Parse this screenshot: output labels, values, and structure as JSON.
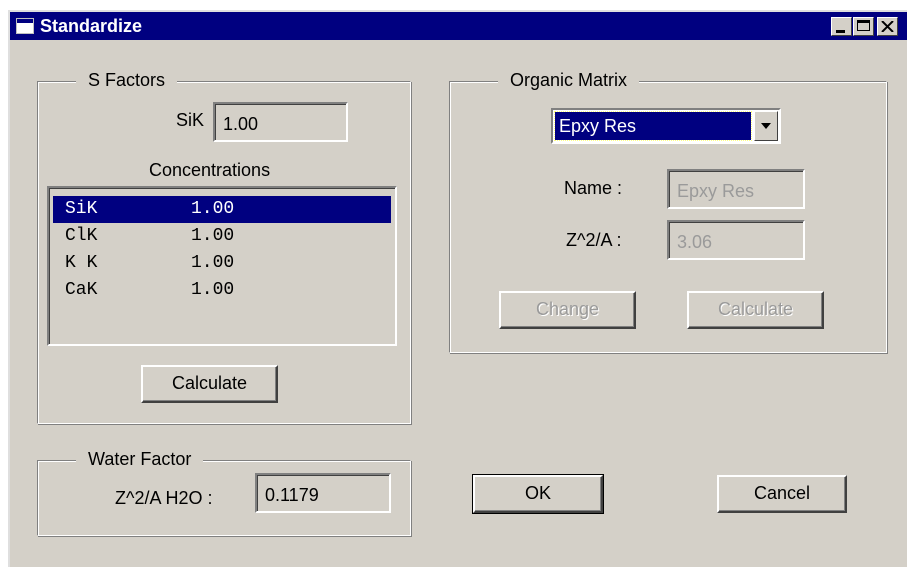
{
  "window": {
    "title": "Standardize"
  },
  "s_factors": {
    "legend": "S Factors",
    "sik_label": "SiK",
    "sik_value": "1.00",
    "concentrations_label": "Concentrations",
    "rows": [
      {
        "name": "SiK",
        "value": "1.00",
        "selected": true
      },
      {
        "name": "ClK",
        "value": "1.00",
        "selected": false
      },
      {
        "name": "K K",
        "value": "1.00",
        "selected": false
      },
      {
        "name": "CaK",
        "value": "1.00",
        "selected": false
      }
    ],
    "calculate_label": "Calculate"
  },
  "organic_matrix": {
    "legend": "Organic Matrix",
    "selected_option": "Epxy Res",
    "name_label": "Name :",
    "name_value": "Epxy Res",
    "z2a_label": "Z^2/A :",
    "z2a_value": "3.06",
    "change_label": "Change",
    "calculate_label": "Calculate"
  },
  "water_factor": {
    "legend": "Water Factor",
    "label": "Z^2/A H2O :",
    "value": "0.1179"
  },
  "buttons": {
    "ok": "OK",
    "cancel": "Cancel"
  },
  "colors": {
    "titlebar": "#000080",
    "face": "#d4d0c8",
    "selection": "#000080"
  }
}
